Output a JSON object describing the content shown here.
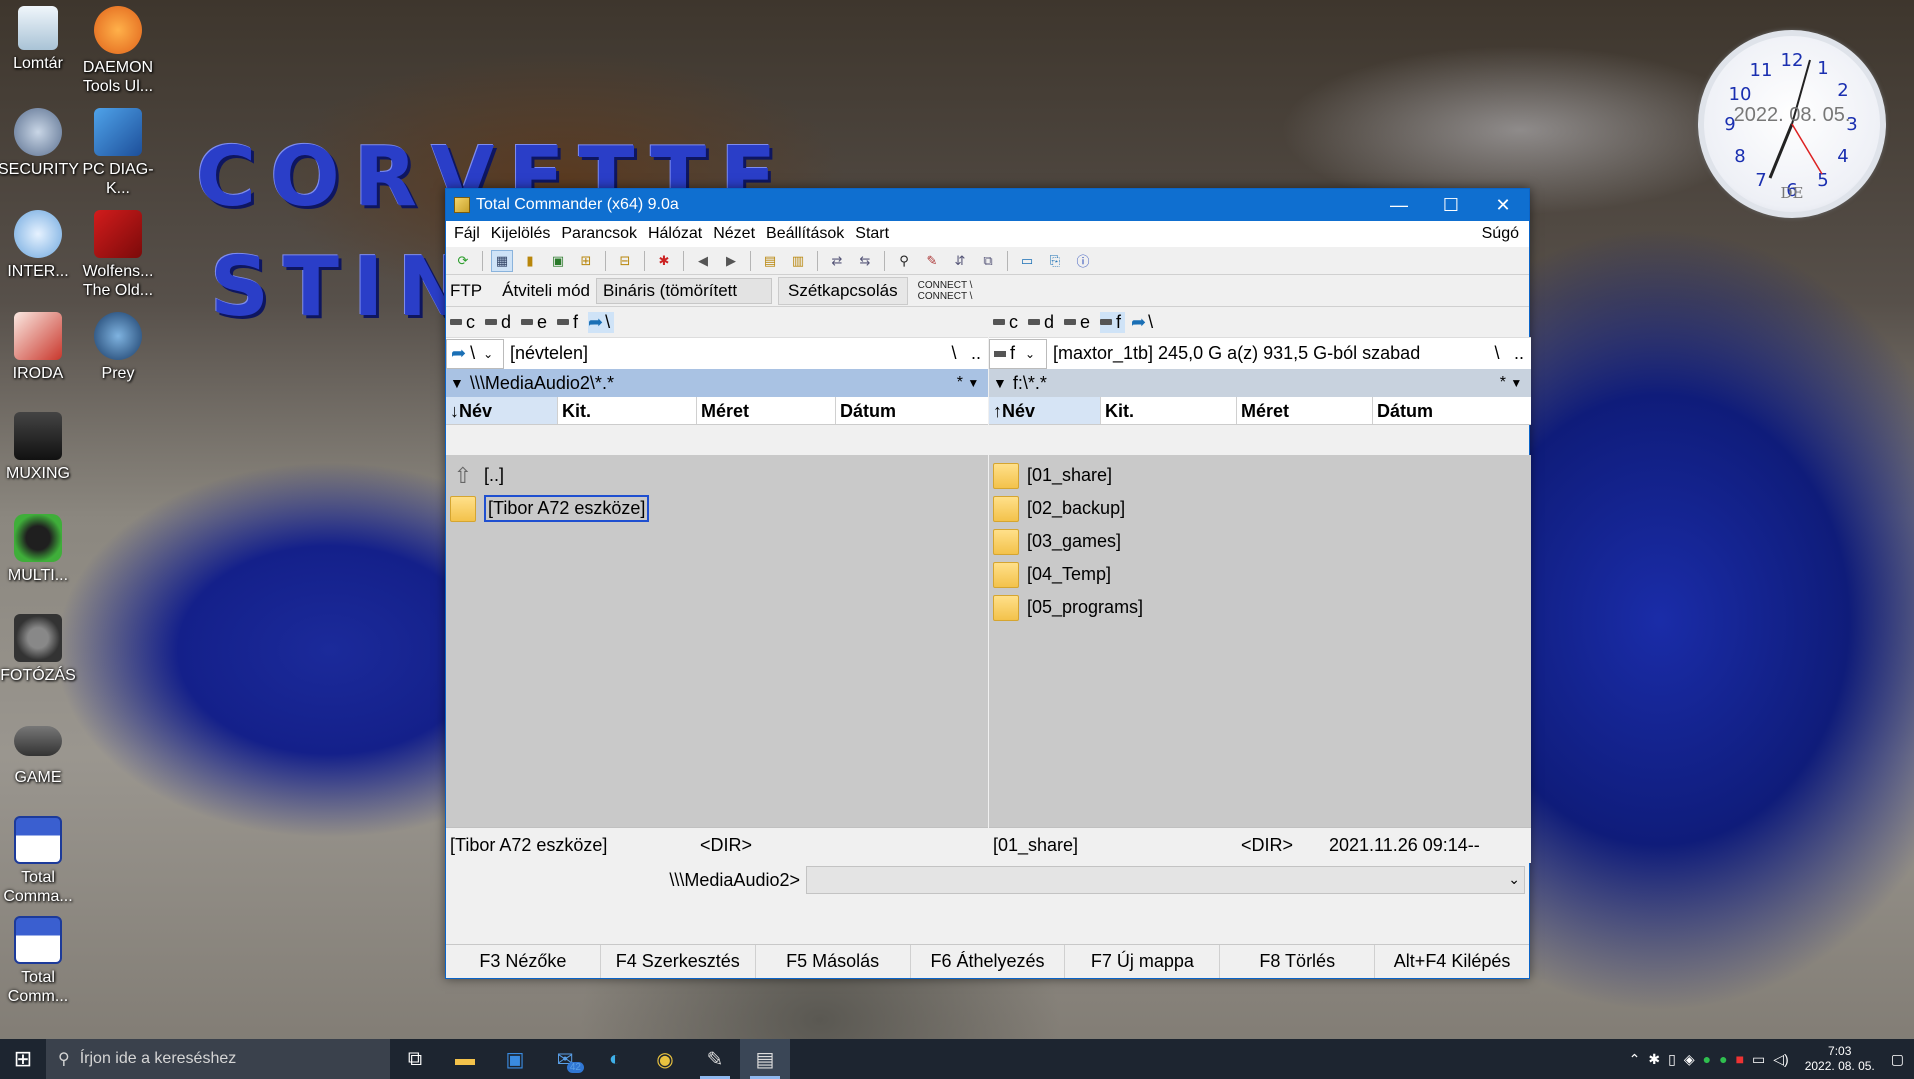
{
  "desktop": {
    "icons": [
      {
        "label": "Lomtár"
      },
      {
        "label": "DAEMON Tools Ul..."
      },
      {
        "label": "SECURITY"
      },
      {
        "label": "PC DIAG-K..."
      },
      {
        "label": "INTER..."
      },
      {
        "label": "Wolfens... The Old..."
      },
      {
        "label": "IRODA"
      },
      {
        "label": "Prey"
      },
      {
        "label": "MUXING"
      },
      {
        "label": "MULTI..."
      },
      {
        "label": "FOTÓZÁS"
      },
      {
        "label": "GAME"
      },
      {
        "label": "Total Comma..."
      },
      {
        "label": "Total Comm..."
      }
    ],
    "wallpaper_text": [
      "CORVETTE",
      "STIN"
    ],
    "clock_widget": {
      "date": "2022. 08. 05.",
      "ampm": "DE"
    }
  },
  "window": {
    "title": "Total Commander (x64) 9.0a",
    "controls": {
      "minimize": "—",
      "maximize": "☐",
      "close": "✕"
    },
    "menu": [
      "Fájl",
      "Kijelölés",
      "Parancsok",
      "Hálózat",
      "Nézet",
      "Beállítások",
      "Start"
    ],
    "menu_help": "Súgó",
    "ftp": {
      "label": "FTP",
      "mode_label": "Átviteli mód",
      "mode_value": "Bináris (tömörített",
      "disconnect": "Szétkapcsolás",
      "log_line1": "CONNECT \\",
      "log_line2": "CONNECT \\"
    },
    "left": {
      "drives": [
        "c",
        "d",
        "e",
        "f",
        "\\"
      ],
      "drive_combo": "\\",
      "volume": "[névtelen]",
      "nav_root": "\\",
      "nav_up": "..",
      "path": "\\\\\\MediaAudio2\\*.*",
      "filter": "*",
      "columns": [
        "Név",
        "Kit.",
        "Méret",
        "Dátum"
      ],
      "sort_arrow": "↓",
      "files": [
        {
          "name": "[..]"
        },
        {
          "name": "[Tibor A72 eszköze]"
        }
      ],
      "status_name": "[Tibor A72 eszköze]",
      "status_size": "<DIR>"
    },
    "right": {
      "drives": [
        "c",
        "d",
        "e",
        "f",
        "\\"
      ],
      "drive_combo": "f",
      "volume": "[maxtor_1tb]  245,0 G a(z) 931,5 G-ból szabad",
      "nav_root": "\\",
      "nav_up": "..",
      "path": "f:\\*.*",
      "filter": "*",
      "columns": [
        "Név",
        "Kit.",
        "Méret",
        "Dátum"
      ],
      "sort_arrow": "↑",
      "files": [
        {
          "name": "[01_share]"
        },
        {
          "name": "[02_backup]"
        },
        {
          "name": "[03_games]"
        },
        {
          "name": "[04_Temp]"
        },
        {
          "name": "[05_programs]"
        }
      ],
      "status_name": "[01_share]",
      "status_size": "<DIR>",
      "status_date": "2021.11.26 09:14--"
    },
    "command_prompt": "\\\\\\MediaAudio2>",
    "fkeys": [
      "F3 Nézőke",
      "F4 Szerkesztés",
      "F5 Másolás",
      "F6 Áthelyezés",
      "F7 Új mappa",
      "F8 Törlés",
      "Alt+F4 Kilépés"
    ]
  },
  "taskbar": {
    "search_placeholder": "Írjon ide a kereséshez",
    "mail_badge": "42",
    "time": "7:03",
    "date": "2022. 08. 05."
  }
}
